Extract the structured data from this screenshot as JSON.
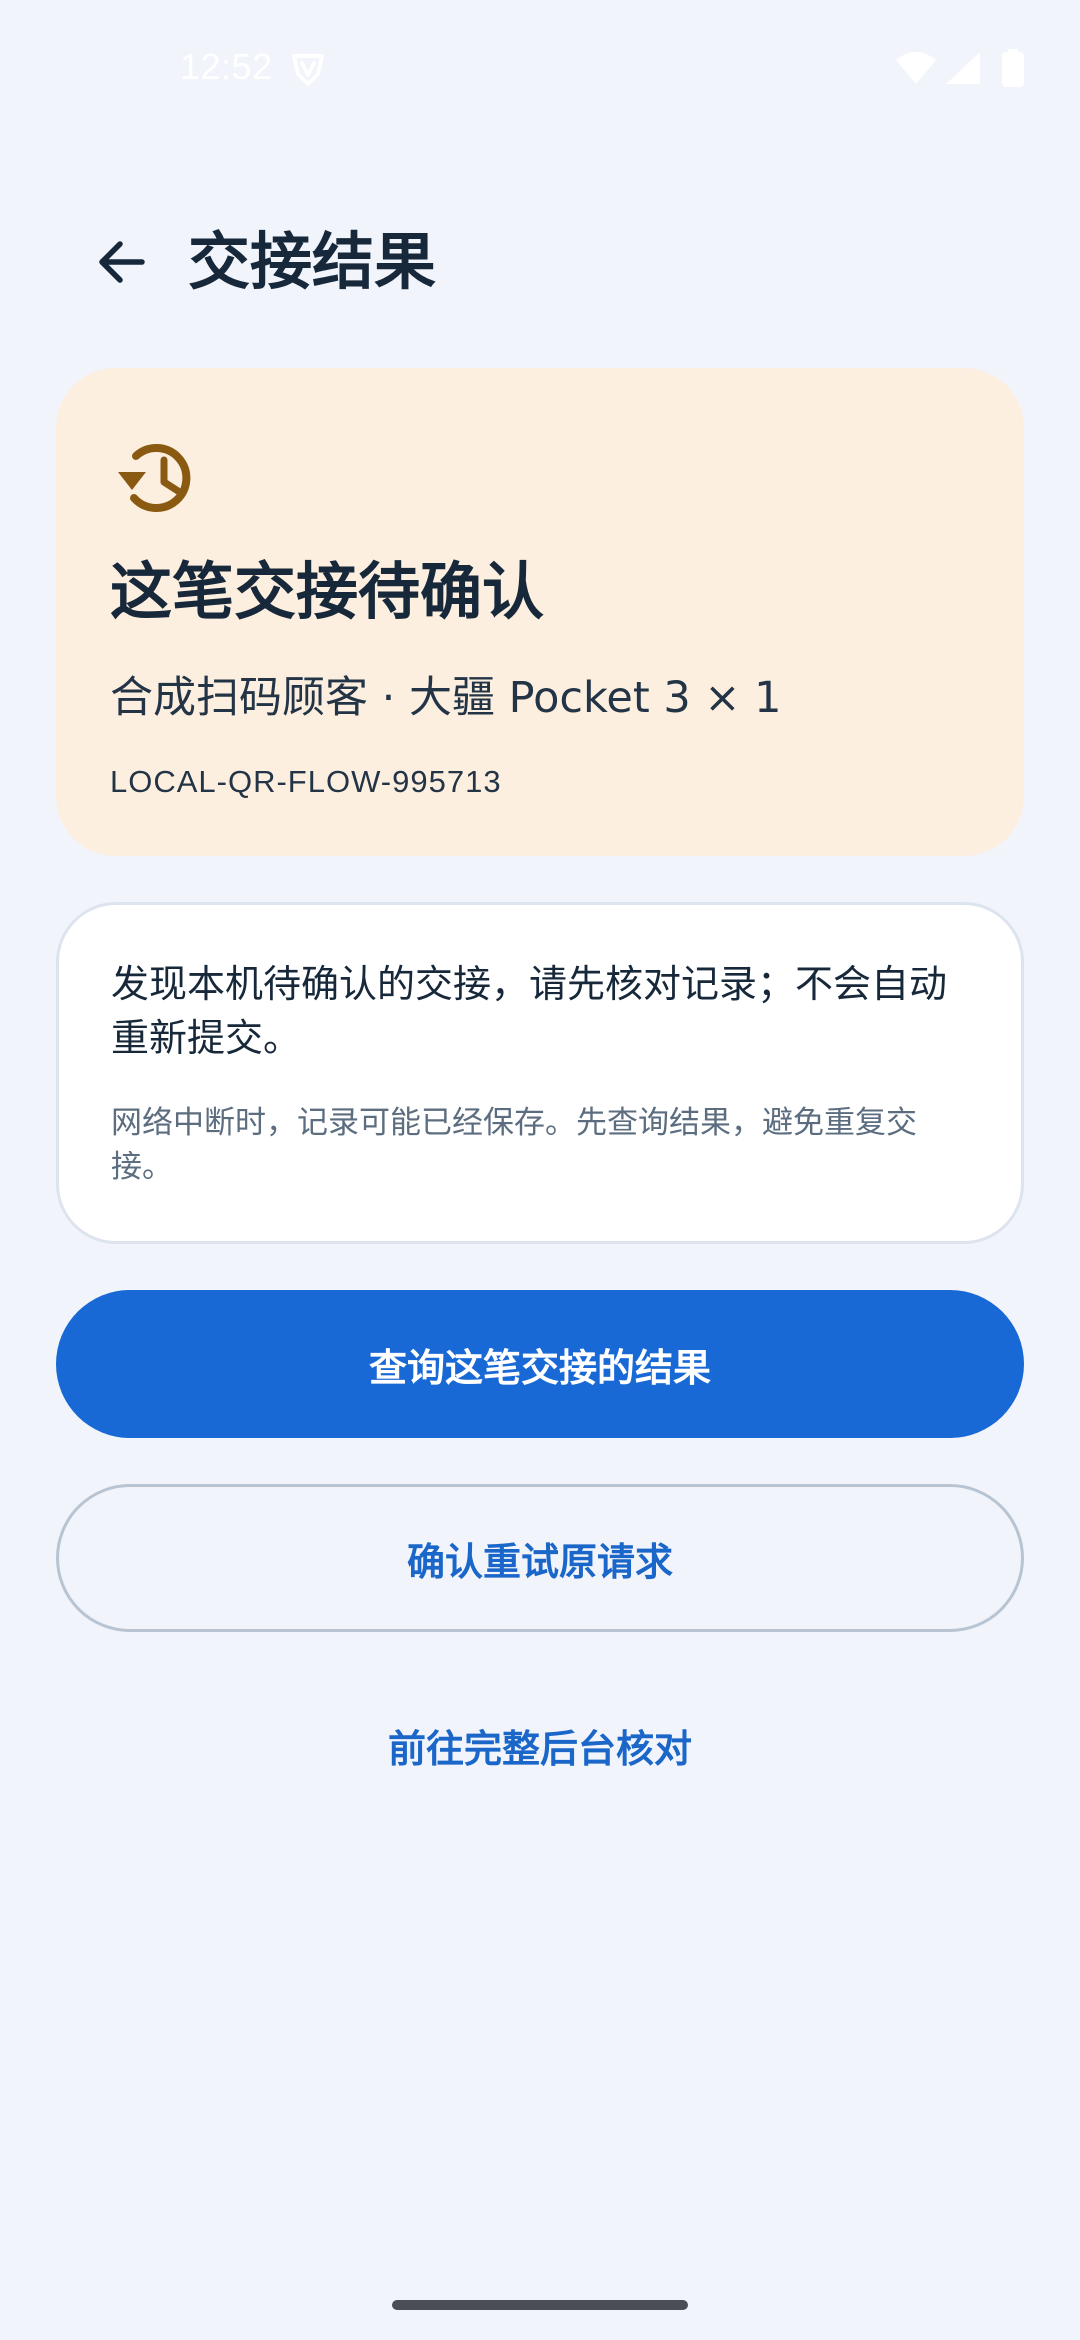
{
  "status_bar": {
    "time": "12:52"
  },
  "header": {
    "title": "交接结果"
  },
  "status_card": {
    "headline": "这笔交接待确认",
    "subtitle": "合成扫码顾客 · 大疆 Pocket 3 × 1",
    "reference": "LOCAL-QR-FLOW-995713",
    "background_color": "#fdefdf",
    "icon_color": "#8b5a12"
  },
  "notice": {
    "main_text": "发现本机待确认的交接，请先核对记录；不会自动重新提交。",
    "sub_text": "网络中断时，记录可能已经保存。先查询结果，避免重复交接。"
  },
  "actions": {
    "primary_label": "查询这笔交接的结果",
    "secondary_label": "确认重试原请求",
    "link_label": "前往完整后台核对"
  },
  "colors": {
    "accent": "#1868d6",
    "background": "#f1f4fb"
  }
}
